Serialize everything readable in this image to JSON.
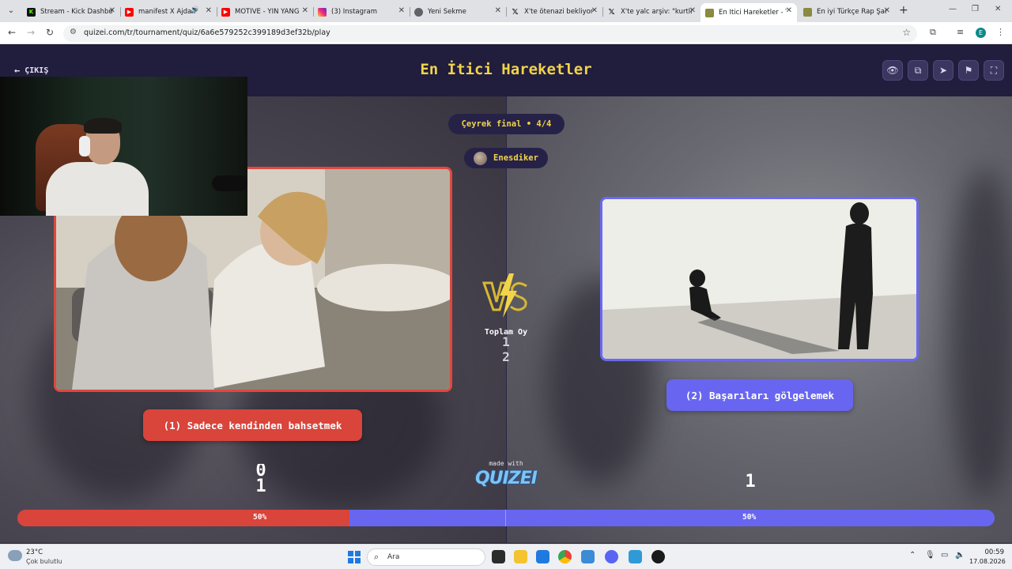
{
  "browser": {
    "tabs": [
      {
        "title": "Stream - Kick Dashbo",
        "icon": "kick-icon",
        "color": "#53fc18"
      },
      {
        "title": "manifest X Ajda P",
        "icon": "youtube-icon",
        "color": "#ff0000"
      },
      {
        "title": "MOTIVE - YIN YANG",
        "icon": "youtube-icon",
        "color": "#ff0000"
      },
      {
        "title": "(3) Instagram",
        "icon": "instagram-icon",
        "color": "#d62976"
      },
      {
        "title": "Yeni Sekme",
        "icon": "chrome-icon",
        "color": "#5f6368"
      },
      {
        "title": "X'te ötenazi bekliyor",
        "icon": "x-icon",
        "color": "#000000"
      },
      {
        "title": "X'te yalc arşiv: \"kurtla",
        "icon": "x-icon",
        "color": "#000000"
      },
      {
        "title": "En İtici Hareketler - T",
        "icon": "quizei-icon",
        "color": "#8a8a40",
        "active": true
      },
      {
        "title": "En iyi Türkçe Rap Şar",
        "icon": "quizei-icon",
        "color": "#8a8a40"
      }
    ],
    "url": "quizei.com/tr/tournament/quiz/6a6e579252c399189d3ef32b/play"
  },
  "quiz": {
    "exit_label": "ÇIKIŞ",
    "title": "En İtici Hareketler",
    "round_label": "Çeyrek final • 4/4",
    "user_name": "Enesdiker",
    "total_votes_label": "Toplam Oy",
    "total_votes_digit": "1",
    "total_votes_digit_next": "2",
    "left_option": "(1) Sadece kendinden bahsetmek",
    "right_option": "(2) Başarıları gölgelemek",
    "left_votes": "0",
    "left_votes_next": "1",
    "right_votes": "1",
    "made_with_label": "made with",
    "brand_name": "QUIZEI",
    "left_percent_label": "50%",
    "right_percent_label": "50%",
    "left_share": 0.5,
    "accent_yellow": "#f1d44a",
    "left_color": "#d9443b",
    "right_color": "#6866f0"
  },
  "taskbar": {
    "temperature": "23°C",
    "weather": "Çok bulutlu",
    "search_placeholder": "Ara",
    "time": "00:59",
    "date": "17.08.2026"
  }
}
